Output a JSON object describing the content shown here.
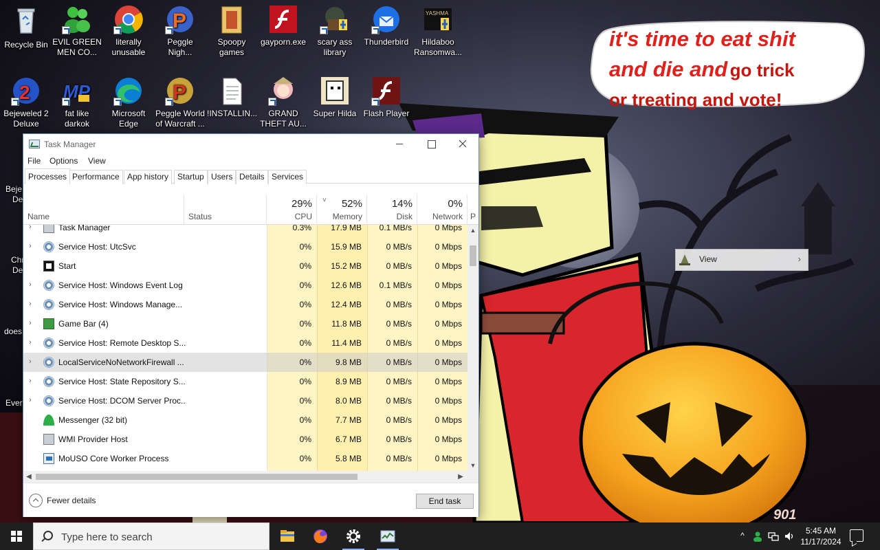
{
  "desktop": {
    "icons_row1": [
      {
        "label": "Recycle Bin",
        "icon": "recycle-bin-icon"
      },
      {
        "label": "EVIL GREEN MEN CO...",
        "icon": "messenger-people-icon"
      },
      {
        "label": "literally unusable",
        "icon": "chrome-icon"
      },
      {
        "label": "Peggle Nigh...",
        "icon": "peggle-icon"
      },
      {
        "label": "Spoopy games",
        "icon": "folder-icon"
      },
      {
        "label": "gayporn.exe",
        "icon": "flash-icon"
      },
      {
        "label": "scary ass library",
        "icon": "library-icon"
      },
      {
        "label": "Thunderbird",
        "icon": "thunderbird-icon"
      },
      {
        "label": "Hildaboo Ransomwa...",
        "icon": "yashma-icon"
      }
    ],
    "icons_row2": [
      {
        "label": "Bejeweled 2 Deluxe",
        "icon": "bejeweled-icon"
      },
      {
        "label": "fat like darkok",
        "icon": "mp-icon"
      },
      {
        "label": "Microsoft Edge",
        "icon": "edge-icon"
      },
      {
        "label": "Peggle World of Warcraft ...",
        "icon": "peggle-wow-icon"
      },
      {
        "label": "!INSTALLIN...",
        "icon": "text-file-icon"
      },
      {
        "label": "GRAND THEFT AU...",
        "icon": "anime-girl-icon"
      },
      {
        "label": "Super Hilda",
        "icon": "super-hilda-icon"
      },
      {
        "label": "Flash Player",
        "icon": "flash-player-icon"
      }
    ],
    "partial_icons": [
      "Beje",
      "De",
      "Chr",
      "De",
      "does",
      "Every"
    ],
    "bubble": {
      "line1": "it's time to eat shit",
      "line2a": "and die and",
      "line2b": "go trick",
      "line3": "or treating and vote!"
    },
    "context_menu": {
      "item": "View",
      "arrow": "›"
    }
  },
  "task_manager": {
    "title": "Task Manager",
    "menu": [
      "File",
      "Options",
      "View"
    ],
    "tabs": [
      "Processes",
      "Performance",
      "App history",
      "Startup",
      "Users",
      "Details",
      "Services"
    ],
    "active_tab": "Processes",
    "columns": {
      "name": "Name",
      "status": "Status",
      "cpu": {
        "pct": "29%",
        "label": "CPU"
      },
      "memory": {
        "pct": "52%",
        "label": "Memory"
      },
      "disk": {
        "pct": "14%",
        "label": "Disk"
      },
      "network": {
        "pct": "0%",
        "label": "Network"
      },
      "power": "P"
    },
    "rows": [
      {
        "name": "Task Manager",
        "cpu": "0.3%",
        "memory": "17.9 MB",
        "disk": "0.1 MB/s",
        "network": "0 Mbps",
        "icon": "task-manager-icon",
        "expand": "›"
      },
      {
        "name": "Service Host: UtcSvc",
        "cpu": "0%",
        "memory": "15.9 MB",
        "disk": "0 MB/s",
        "network": "0 Mbps",
        "icon": "service-gear-icon",
        "expand": "›"
      },
      {
        "name": "Start",
        "cpu": "0%",
        "memory": "15.2 MB",
        "disk": "0 MB/s",
        "network": "0 Mbps",
        "icon": "start-app-icon",
        "expand": ""
      },
      {
        "name": "Service Host: Windows Event Log",
        "cpu": "0%",
        "memory": "12.6 MB",
        "disk": "0.1 MB/s",
        "network": "0 Mbps",
        "icon": "service-gear-icon",
        "expand": "›"
      },
      {
        "name": "Service Host: Windows Manage...",
        "cpu": "0%",
        "memory": "12.4 MB",
        "disk": "0 MB/s",
        "network": "0 Mbps",
        "icon": "service-gear-icon",
        "expand": "›"
      },
      {
        "name": "Game Bar (4)",
        "cpu": "0%",
        "memory": "11.8 MB",
        "disk": "0 MB/s",
        "network": "0 Mbps",
        "icon": "game-bar-icon",
        "expand": "›"
      },
      {
        "name": "Service Host: Remote Desktop S...",
        "cpu": "0%",
        "memory": "11.4 MB",
        "disk": "0 MB/s",
        "network": "0 Mbps",
        "icon": "service-gear-icon",
        "expand": "›"
      },
      {
        "name": "LocalServiceNoNetworkFirewall ...",
        "cpu": "0%",
        "memory": "9.8 MB",
        "disk": "0 MB/s",
        "network": "0 Mbps",
        "icon": "service-gear-icon",
        "expand": "›",
        "selected": true
      },
      {
        "name": "Service Host: State Repository S...",
        "cpu": "0%",
        "memory": "8.9 MB",
        "disk": "0 MB/s",
        "network": "0 Mbps",
        "icon": "service-gear-icon",
        "expand": "›"
      },
      {
        "name": "Service Host: DCOM Server Proc...",
        "cpu": "0%",
        "memory": "8.0 MB",
        "disk": "0 MB/s",
        "network": "0 Mbps",
        "icon": "service-gear-icon",
        "expand": "›"
      },
      {
        "name": "Messenger (32 bit)",
        "cpu": "0%",
        "memory": "7.7 MB",
        "disk": "0 MB/s",
        "network": "0 Mbps",
        "icon": "messenger-icon",
        "expand": ""
      },
      {
        "name": "WMI Provider Host",
        "cpu": "0%",
        "memory": "6.7 MB",
        "disk": "0 MB/s",
        "network": "0 Mbps",
        "icon": "wmi-icon",
        "expand": ""
      },
      {
        "name": "MoUSO Core Worker Process",
        "cpu": "0%",
        "memory": "5.8 MB",
        "disk": "0 MB/s",
        "network": "0 Mbps",
        "icon": "mouso-icon",
        "expand": ""
      }
    ],
    "footer": {
      "fewer_details": "Fewer details",
      "end_task": "End task"
    },
    "sort_arrow": "˅",
    "scroll_arrows": {
      "up": "▲",
      "down": "▼",
      "left": "◀",
      "right": "▶"
    }
  },
  "taskbar": {
    "search_placeholder": "Type here to search",
    "apps": [
      "file-explorer-icon",
      "firefox-icon",
      "settings-gear-icon",
      "task-manager-icon"
    ],
    "tray": {
      "chevron": "^"
    },
    "clock": {
      "time": "5:45 AM",
      "date": "11/17/2024"
    }
  },
  "colors": {
    "taskbar": "#1f1f1f",
    "column_highlight": "#fff4c4",
    "bubble_text": "#e0201b",
    "window_border": "#6a8fb5"
  }
}
